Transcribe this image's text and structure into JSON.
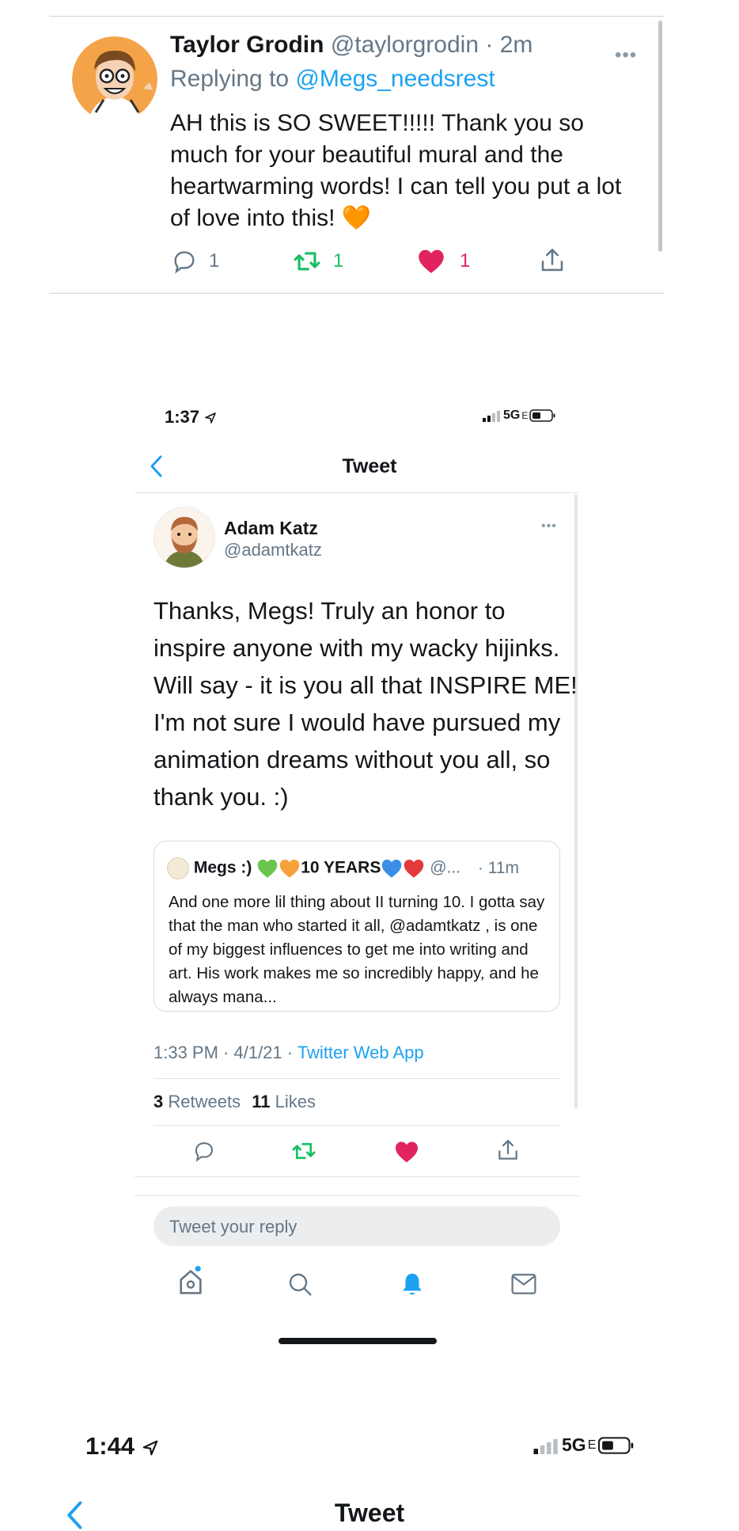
{
  "top_tweet": {
    "name": "Taylor Grodin",
    "handle": "@taylorgrodin",
    "sep": "·",
    "time": "2m",
    "replying_prefix": "Replying to",
    "replying_handle": "@Megs_needsrest",
    "text": "AH this is SO SWEET!!!!! Thank you so much for your beautiful mural and the heartwarming words! I can tell you put a lot of love into this!",
    "emoji": "🧡",
    "reply_count": "1",
    "retweet_count": "1",
    "like_count": "1"
  },
  "mid_screenshot": {
    "status_time": "1:37",
    "network": "5G",
    "network_suffix": "E",
    "nav_title": "Tweet",
    "tweet": {
      "name": "Adam Katz",
      "handle": "@adamtkatz",
      "text": "Thanks, Megs! Truly an honor to inspire anyone with my wacky hijinks. Will say - it is you all that INSPIRE ME! I'm not sure I would have pursued my animation dreams without you all, so thank you. :)",
      "quote": {
        "name_prefix": "Megs :)",
        "name_mid": "10 YEARS",
        "handle_trunc": "@...",
        "time": "· 11m",
        "text": "And one more lil thing about II turning 10. I gotta say that the man who started it all, @adamtkatz , is one of my biggest influences to get me into writing and art. His work makes me so incredibly happy, and he always mana..."
      },
      "timestamp": "1:33 PM · 4/1/21 · ",
      "source": "Twitter Web App",
      "retweets_count": "3",
      "retweets_label": "Retweets",
      "likes_count": "11",
      "likes_label": "Likes"
    },
    "reply_placeholder": "Tweet your reply"
  },
  "bottom_screenshot": {
    "status_time": "1:44",
    "network": "5G",
    "network_suffix": "E",
    "nav_title": "Tweet"
  },
  "colors": {
    "link": "#1da1f2",
    "like": "#e0245e",
    "retweet": "#17bf63",
    "secondary": "#657786"
  }
}
